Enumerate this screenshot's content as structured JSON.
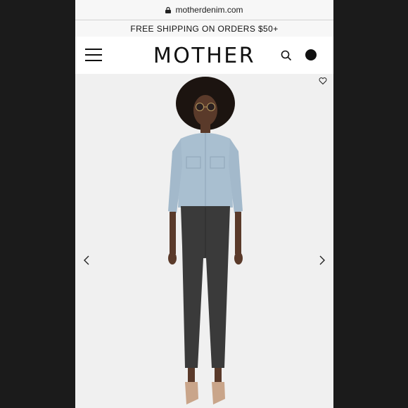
{
  "browser": {
    "url": "motherdenim.com"
  },
  "promo": {
    "text": "FREE SHIPPING ON ORDERS $50+"
  },
  "header": {
    "logo": "MOTHER"
  },
  "icons": {
    "menu": "hamburger-menu-icon",
    "search": "search-icon",
    "bag": "bag-icon",
    "wishlist": "heart-icon",
    "prev": "chevron-left-icon",
    "next": "chevron-right-icon"
  },
  "colors": {
    "background": "#f0f0f0",
    "text": "#111111",
    "denim_shirt": "#a9bfd0",
    "jeans": "#3a3a3a"
  }
}
